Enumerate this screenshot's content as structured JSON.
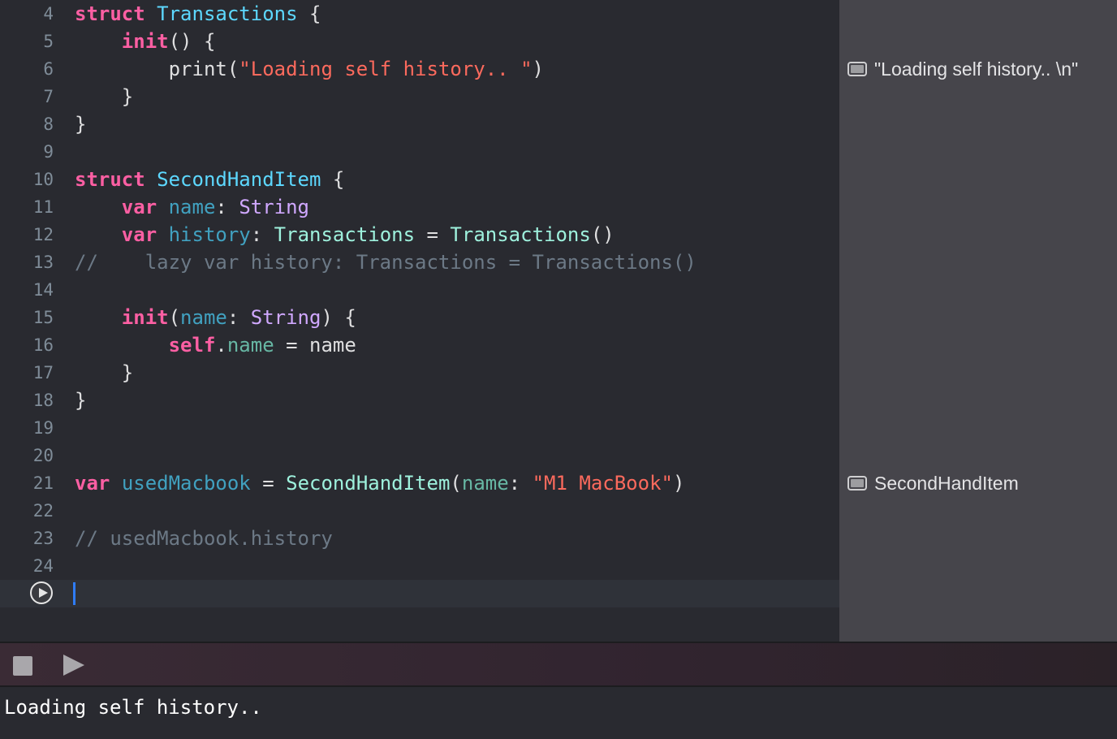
{
  "editor": {
    "lines": [
      {
        "number": "4",
        "tokens": [
          {
            "text": "struct",
            "cls": "kw"
          },
          {
            "text": " "
          },
          {
            "text": "Transactions",
            "cls": "typedecl"
          },
          {
            "text": " {"
          }
        ]
      },
      {
        "number": "5",
        "tokens": [
          {
            "text": "    "
          },
          {
            "text": "init",
            "cls": "kw"
          },
          {
            "text": "() {"
          }
        ]
      },
      {
        "number": "6",
        "tokens": [
          {
            "text": "        print("
          },
          {
            "text": "\"Loading self history.. \"",
            "cls": "str"
          },
          {
            "text": ")"
          }
        ]
      },
      {
        "number": "7",
        "tokens": [
          {
            "text": "    }"
          }
        ]
      },
      {
        "number": "8",
        "tokens": [
          {
            "text": "}"
          }
        ]
      },
      {
        "number": "9",
        "tokens": []
      },
      {
        "number": "10",
        "tokens": [
          {
            "text": "struct",
            "cls": "kw"
          },
          {
            "text": " "
          },
          {
            "text": "SecondHandItem",
            "cls": "typedecl"
          },
          {
            "text": " {"
          }
        ]
      },
      {
        "number": "11",
        "tokens": [
          {
            "text": "    "
          },
          {
            "text": "var",
            "cls": "kw"
          },
          {
            "text": " "
          },
          {
            "text": "name",
            "cls": "var"
          },
          {
            "text": ": "
          },
          {
            "text": "String",
            "cls": "type"
          }
        ]
      },
      {
        "number": "12",
        "tokens": [
          {
            "text": "    "
          },
          {
            "text": "var",
            "cls": "kw"
          },
          {
            "text": " "
          },
          {
            "text": "history",
            "cls": "var"
          },
          {
            "text": ": "
          },
          {
            "text": "Transactions",
            "cls": "ptype"
          },
          {
            "text": " = "
          },
          {
            "text": "Transactions",
            "cls": "ptype"
          },
          {
            "text": "()"
          }
        ]
      },
      {
        "number": "13",
        "tokens": [
          {
            "text": "//    lazy var history: Transactions = Transactions()",
            "cls": "cmt"
          }
        ]
      },
      {
        "number": "14",
        "tokens": []
      },
      {
        "number": "15",
        "tokens": [
          {
            "text": "    "
          },
          {
            "text": "init",
            "cls": "kw"
          },
          {
            "text": "("
          },
          {
            "text": "name",
            "cls": "var"
          },
          {
            "text": ": "
          },
          {
            "text": "String",
            "cls": "type"
          },
          {
            "text": ") {"
          }
        ]
      },
      {
        "number": "16",
        "tokens": [
          {
            "text": "        "
          },
          {
            "text": "self",
            "cls": "kw"
          },
          {
            "text": "."
          },
          {
            "text": "name",
            "cls": "prop"
          },
          {
            "text": " = name"
          }
        ]
      },
      {
        "number": "17",
        "tokens": [
          {
            "text": "    }"
          }
        ]
      },
      {
        "number": "18",
        "tokens": [
          {
            "text": "}"
          }
        ]
      },
      {
        "number": "19",
        "tokens": []
      },
      {
        "number": "20",
        "tokens": []
      },
      {
        "number": "21",
        "tokens": [
          {
            "text": "var",
            "cls": "kw"
          },
          {
            "text": " "
          },
          {
            "text": "usedMacbook",
            "cls": "var"
          },
          {
            "text": " = "
          },
          {
            "text": "SecondHandItem",
            "cls": "ptype"
          },
          {
            "text": "("
          },
          {
            "text": "name",
            "cls": "prop"
          },
          {
            "text": ": "
          },
          {
            "text": "\"M1 MacBook\"",
            "cls": "str"
          },
          {
            "text": ")"
          }
        ]
      },
      {
        "number": "22",
        "tokens": []
      },
      {
        "number": "23",
        "tokens": [
          {
            "text": "// usedMacbook.history",
            "cls": "cmt"
          }
        ]
      },
      {
        "number": "24",
        "tokens": []
      },
      {
        "number": "",
        "tokens": [],
        "current": true
      }
    ]
  },
  "results": [
    {
      "line": "6",
      "text": "\"Loading self history.. \\n\"",
      "icon": "quicklook-icon"
    },
    {
      "line": "21",
      "text": "SecondHandItem",
      "icon": "quicklook-icon"
    }
  ],
  "debug_bar": {
    "stop_icon": "stop-icon",
    "run_icon": "play-icon"
  },
  "console": {
    "output": "Loading self history.."
  }
}
